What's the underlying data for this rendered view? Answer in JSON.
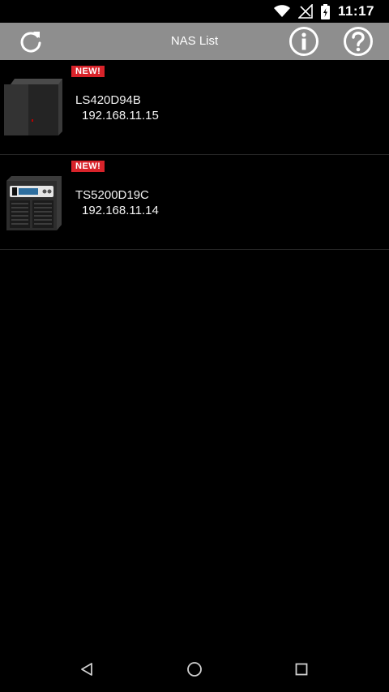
{
  "status_bar": {
    "time": "11:17",
    "icons": [
      "wifi-icon",
      "no-signal-icon",
      "battery-icon"
    ]
  },
  "toolbar": {
    "title": "NAS List",
    "icons": [
      "refresh-icon",
      "info-icon",
      "help-icon"
    ],
    "background": "#8e8e8e"
  },
  "nas_list": [
    {
      "badge": "NEW!",
      "name": "LS420D94B",
      "ip": "192.168.11.15",
      "icon": "nas-device-icon"
    },
    {
      "badge": "NEW!",
      "name": "TS5200D19C",
      "ip": "192.168.11.14",
      "icon": "nas-device-icon"
    }
  ],
  "nav_bar": {
    "icons": [
      "back-icon",
      "home-icon",
      "recent-apps-icon"
    ]
  },
  "colors": {
    "badge": "#d8232a",
    "background": "#000000",
    "divider": "#262626"
  }
}
